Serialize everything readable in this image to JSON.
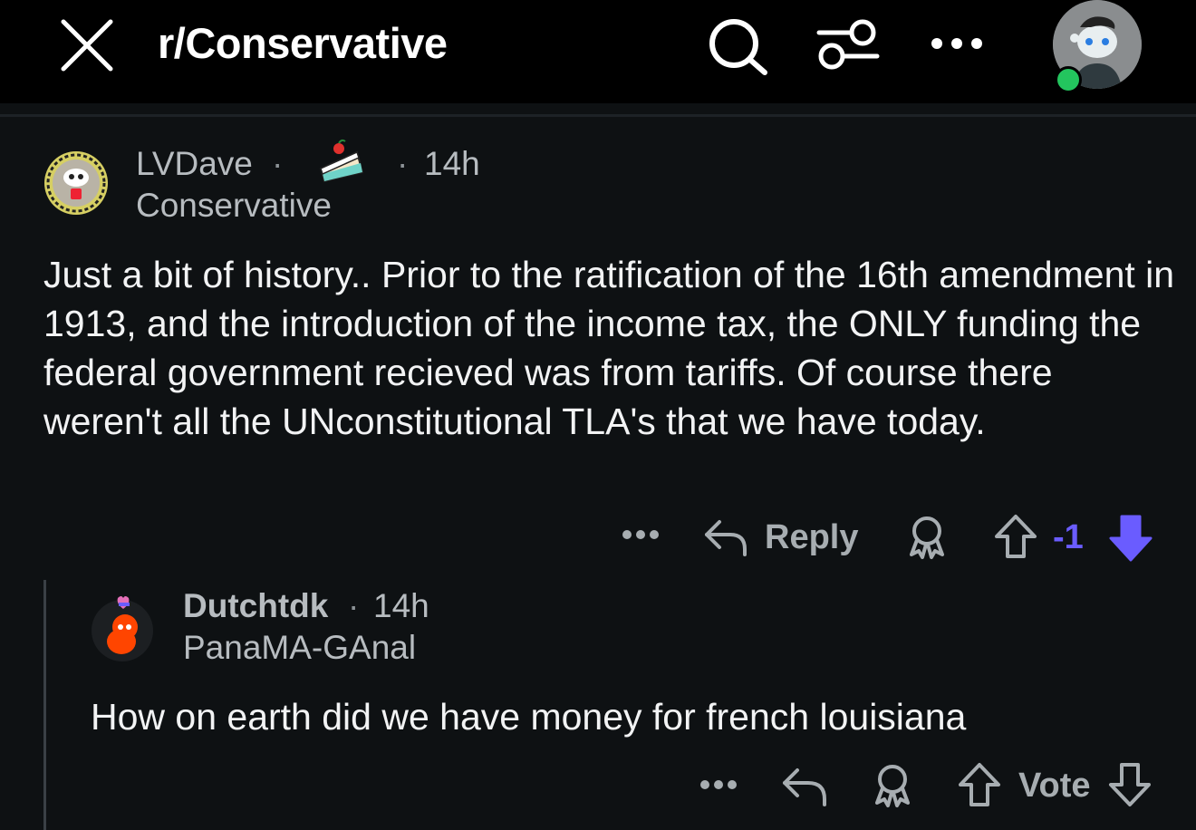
{
  "header": {
    "title": "r/Conservative",
    "icons": [
      "close-icon",
      "search-icon",
      "filter-icon",
      "more-icon",
      "avatar"
    ]
  },
  "comments": [
    {
      "username": "LVDave",
      "dot": "·",
      "badge": "cake-day-icon",
      "time_dot": "·",
      "time": "14h",
      "flair": "Conservative",
      "body": "Just a bit of history.. Prior to the ratification of the 16th amendment in 1913, and the introduction of the income tax, the ONLY funding the federal government recieved was from tariffs. Of course there weren't all the UNconstitutional TLA's that we have today.",
      "actions": {
        "reply_label": "Reply",
        "score": "-1"
      }
    },
    {
      "username": "Dutchtdk",
      "dot": "·",
      "time": "14h",
      "flair": "PanaMA-GAnal",
      "body": "How on earth did we have money for french louisiana",
      "actions": {
        "vote_label": "Vote"
      }
    }
  ],
  "colors": {
    "background": "#0e1113",
    "header": "#000000",
    "downvote": "#6a5cff",
    "online": "#23c55e"
  }
}
